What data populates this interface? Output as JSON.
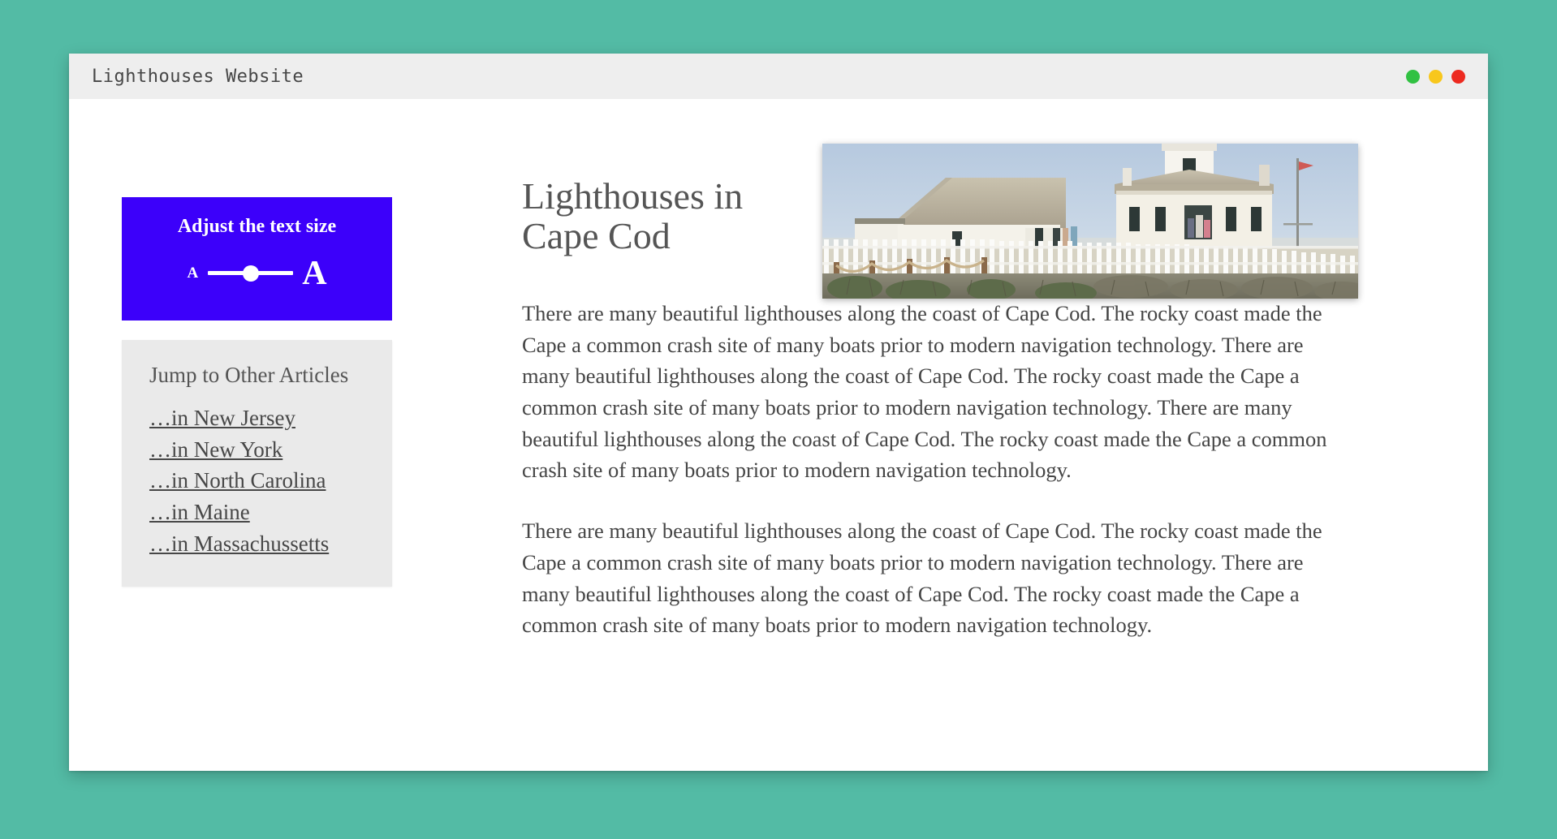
{
  "desktop": {
    "background_color": "#53bba5"
  },
  "window": {
    "title": "Lighthouses Website",
    "controls": [
      {
        "name": "minimize",
        "color": "#31c142"
      },
      {
        "name": "maximize",
        "color": "#f8c71c"
      },
      {
        "name": "close",
        "color": "#ed2a20"
      }
    ]
  },
  "sidebar": {
    "text_size_widget": {
      "heading": "Adjust the text size",
      "background_color": "#3c00fa",
      "small_label": "A",
      "large_label": "A",
      "slider_value": 50
    },
    "jump_panel": {
      "heading": "Jump to Other Articles",
      "background_color": "#eaeaea",
      "links": [
        "…in New Jersey",
        "…in New York",
        "…in North Carolina",
        "…in Maine",
        "…in Massachussetts"
      ]
    }
  },
  "main": {
    "title": "Lighthouses in Cape Cod",
    "hero_image": {
      "alt": "Lighthouse station with white keeper's houses, picket fence, flagpole and coastal scrub"
    },
    "paragraphs": [
      "There are many beautiful lighthouses along the coast of Cape Cod. The rocky coast made the Cape a common crash site of many boats prior to modern navigation technology. There are many beautiful lighthouses along the coast of Cape Cod. The rocky coast made the Cape a common crash site of many boats prior to modern navigation technology. There are many beautiful lighthouses along the coast of Cape Cod. The rocky coast made the Cape a common crash site of many boats prior to modern navigation technology.",
      "There are many beautiful lighthouses along the coast of Cape Cod. The rocky coast made the Cape a common crash site of many boats prior to modern navigation technology. There are many beautiful lighthouses along the coast of Cape Cod. The rocky coast made the Cape a common crash site of many boats prior to modern navigation technology."
    ]
  }
}
